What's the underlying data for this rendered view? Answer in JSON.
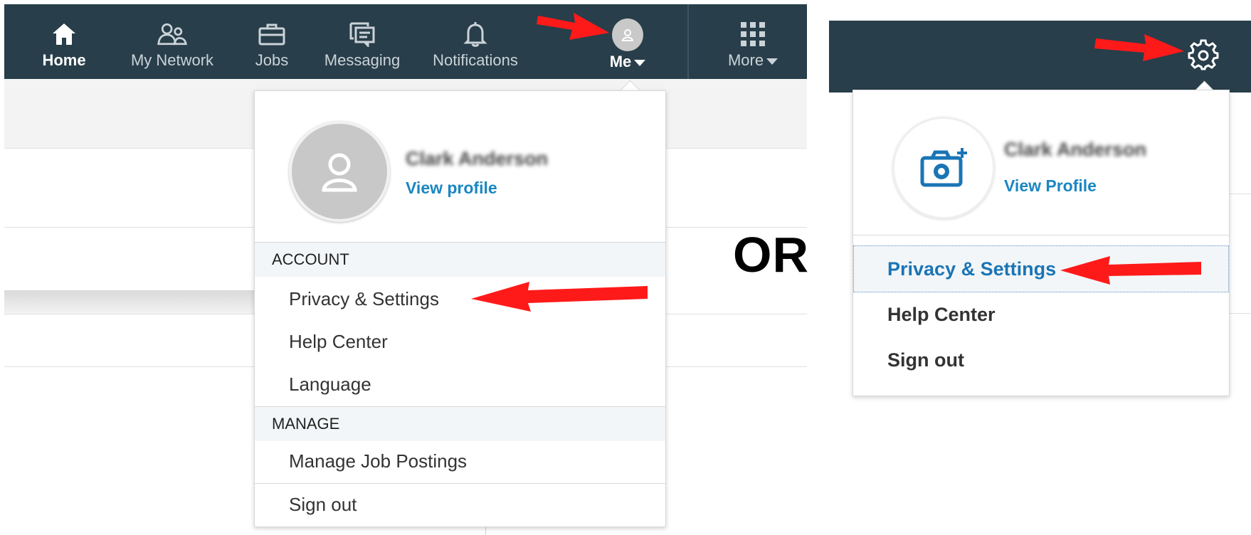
{
  "left_nav": {
    "items": [
      {
        "label": "Home",
        "icon": "home-icon"
      },
      {
        "label": "My Network",
        "icon": "people-icon"
      },
      {
        "label": "Jobs",
        "icon": "briefcase-icon"
      },
      {
        "label": "Messaging",
        "icon": "messaging-icon"
      },
      {
        "label": "Notifications",
        "icon": "bell-icon"
      },
      {
        "label": "Me",
        "icon": "avatar-icon"
      },
      {
        "label": "More",
        "icon": "grid-icon"
      }
    ]
  },
  "me_menu": {
    "name": "Clark Anderson",
    "view_profile": "View profile",
    "section_account": "ACCOUNT",
    "account_items": [
      "Privacy & Settings",
      "Help Center",
      "Language"
    ],
    "section_manage": "MANAGE",
    "manage_items": [
      "Manage Job Postings"
    ],
    "sign_out": "Sign out"
  },
  "separator_text": "OR",
  "settings_menu": {
    "name": "Clark Anderson",
    "view_profile": "View Profile",
    "items": [
      "Privacy & Settings",
      "Help Center",
      "Sign out"
    ],
    "selected_index": 0
  },
  "colors": {
    "navbar": "#283e4a",
    "link": "#1a86c2",
    "arrow": "#ff1a1a"
  }
}
